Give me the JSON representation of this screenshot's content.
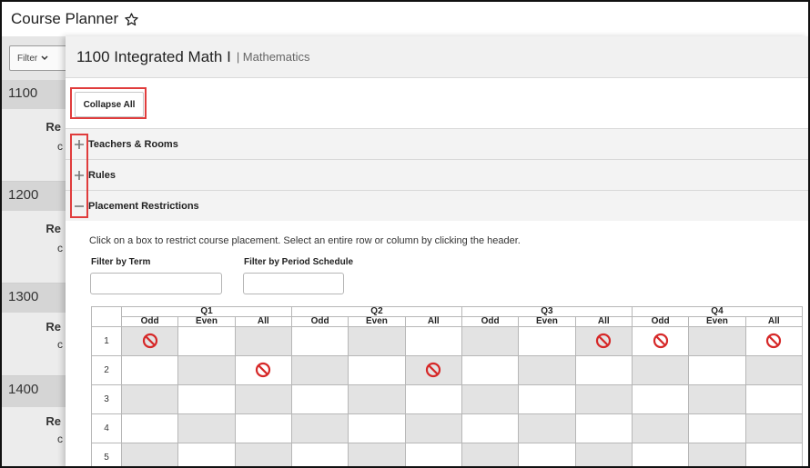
{
  "app": {
    "title": "Course Planner",
    "star_icon": "star-outline-icon"
  },
  "left_panel": {
    "filter_label": "Filter",
    "groups": [
      {
        "num": "1100",
        "re": "Re",
        "c": "c"
      },
      {
        "num": "1200",
        "re": "Re",
        "c": "c"
      },
      {
        "num": "1300",
        "re": "Re",
        "c": "c"
      },
      {
        "num": "1400",
        "re": "Re",
        "c": "c"
      }
    ]
  },
  "course": {
    "title": "1100 Integrated Math I",
    "department": "| Mathematics"
  },
  "collapse_all_label": "Collapse All",
  "sections": [
    {
      "label": "Teachers & Rooms",
      "state": "collapsed",
      "icon": "plus-icon"
    },
    {
      "label": "Rules",
      "state": "collapsed",
      "icon": "plus-icon"
    },
    {
      "label": "Placement Restrictions",
      "state": "expanded",
      "icon": "minus-icon"
    }
  ],
  "placement": {
    "instructions": "Click on a box to restrict course placement. Select an entire row or column by clicking the header.",
    "filter_term_label": "Filter by Term",
    "filter_term_value": "",
    "filter_period_label": "Filter by Period Schedule",
    "filter_period_value": "",
    "terms": [
      "Q1",
      "Q2",
      "Q3",
      "Q4"
    ],
    "columns": [
      "Odd",
      "Even",
      "All",
      "Odd",
      "Even",
      "All",
      "Odd",
      "Even",
      "All",
      "Odd",
      "Even",
      "All"
    ],
    "rows": [
      "1",
      "2",
      "3",
      "4",
      "5"
    ],
    "restricted": [
      [
        0,
        8,
        9,
        11
      ],
      [
        2,
        5
      ],
      [],
      [],
      []
    ]
  },
  "colors": {
    "highlight": "#e03c3c",
    "restricted_icon": "#d62828",
    "shaded_cell": "#e3e3e3"
  }
}
